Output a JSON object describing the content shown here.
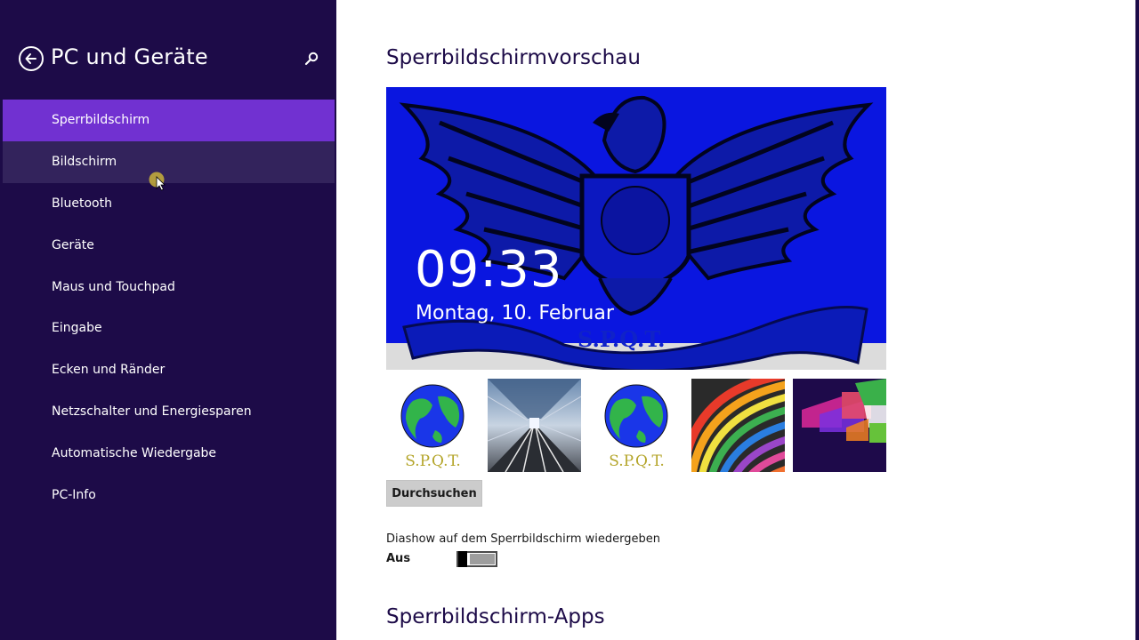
{
  "header": {
    "title": "PC und Geräte",
    "back_icon": "back-arrow-icon",
    "search_icon": "search-icon"
  },
  "sidebar": {
    "selected": "Sperrbildschirm",
    "hovered": "Bildschirm",
    "items": [
      {
        "label": "Sperrbildschirm"
      },
      {
        "label": "Bildschirm"
      },
      {
        "label": "Bluetooth"
      },
      {
        "label": "Geräte"
      },
      {
        "label": "Maus und Touchpad"
      },
      {
        "label": "Eingabe"
      },
      {
        "label": "Ecken und Ränder"
      },
      {
        "label": "Netzschalter und Energiesparen"
      },
      {
        "label": "Automatische Wiedergabe"
      },
      {
        "label": "PC-Info"
      }
    ]
  },
  "main": {
    "preview_title": "Sperrbildschirmvorschau",
    "lock_screen": {
      "time": "09:33",
      "date": "Montag, 10. Februar",
      "emblem_text": "S.P.Q.T."
    },
    "thumbnails": [
      {
        "name": "globe-spqt",
        "caption": "S.P.Q.T."
      },
      {
        "name": "subway-tunnel",
        "caption": ""
      },
      {
        "name": "globe-spqt",
        "caption": "S.P.Q.T."
      },
      {
        "name": "color-curves",
        "caption": ""
      },
      {
        "name": "tiles-abstract",
        "caption": ""
      }
    ],
    "browse_label": "Durchsuchen",
    "slideshow": {
      "label": "Diashow auf dem Sperrbildschirm wiedergeben",
      "state": "Aus",
      "on": false
    },
    "apps_title": "Sperrbildschirm-Apps"
  },
  "colors": {
    "sidebar_bg": "#1d0b48",
    "selected_bg": "#7131d1",
    "hover_bg": "#33235c",
    "accent_text": "#1d0b48",
    "lock_bg": "#0a16e0"
  }
}
